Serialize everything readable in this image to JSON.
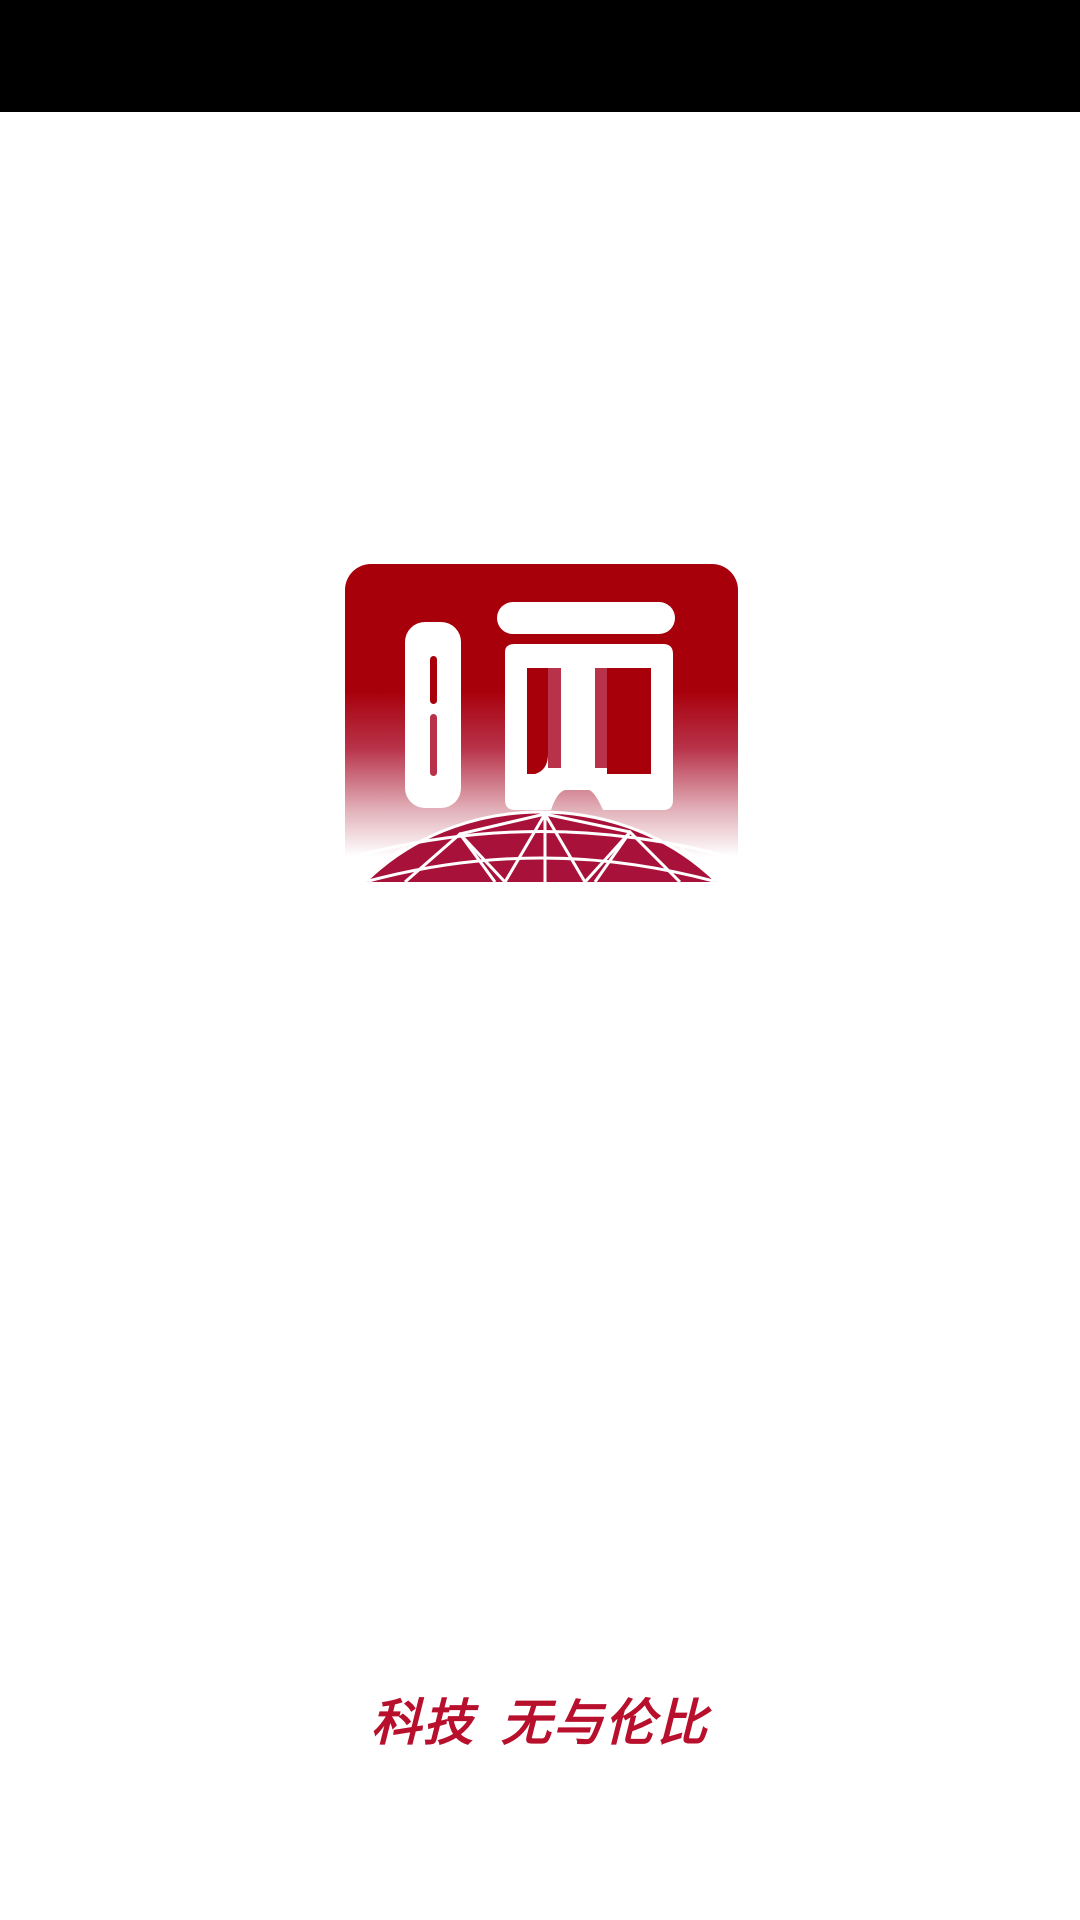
{
  "splash": {
    "slogan": {
      "part1": "科技",
      "part2": "无与伦比"
    },
    "logo": {
      "icon": "app-logo-icon",
      "glyph": "晒"
    }
  },
  "colors": {
    "brand_red": "#a8000b",
    "globe_red": "#a8123a",
    "slogan_red": "#b8102c",
    "status_bar": "#000000",
    "background": "#ffffff"
  }
}
